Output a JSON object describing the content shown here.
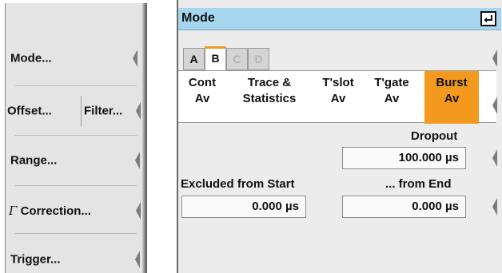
{
  "softkeys": {
    "mode": "Mode...",
    "offset": "Offset...",
    "filter": "Filter...",
    "range": "Range...",
    "correction_symbol": "Γ",
    "correction": "Correction...",
    "trigger": "Trigger..."
  },
  "window": {
    "title": "Mode",
    "tabs": [
      {
        "label": "A",
        "state": "normal"
      },
      {
        "label": "B",
        "state": "active"
      },
      {
        "label": "C",
        "state": "disabled"
      },
      {
        "label": "D",
        "state": "disabled"
      }
    ],
    "modes": [
      {
        "line1": "Cont",
        "line2": "Av",
        "selected": false
      },
      {
        "line1": "Trace &",
        "line2": "Statistics",
        "selected": false
      },
      {
        "line1": "T'slot",
        "line2": "Av",
        "selected": false
      },
      {
        "line1": "T'gate",
        "line2": "Av",
        "selected": false
      },
      {
        "line1": "Burst",
        "line2": "Av",
        "selected": true
      }
    ],
    "dropout": {
      "label": "Dropout",
      "value": "100.000 µs"
    },
    "excluded_start": {
      "label": "Excluded from Start",
      "value": "0.000 µs"
    },
    "excluded_end": {
      "label": "... from End",
      "value": "0.000 µs"
    }
  },
  "colors": {
    "accent": "#f39a1e",
    "titlebar": "#a6d6ee"
  }
}
